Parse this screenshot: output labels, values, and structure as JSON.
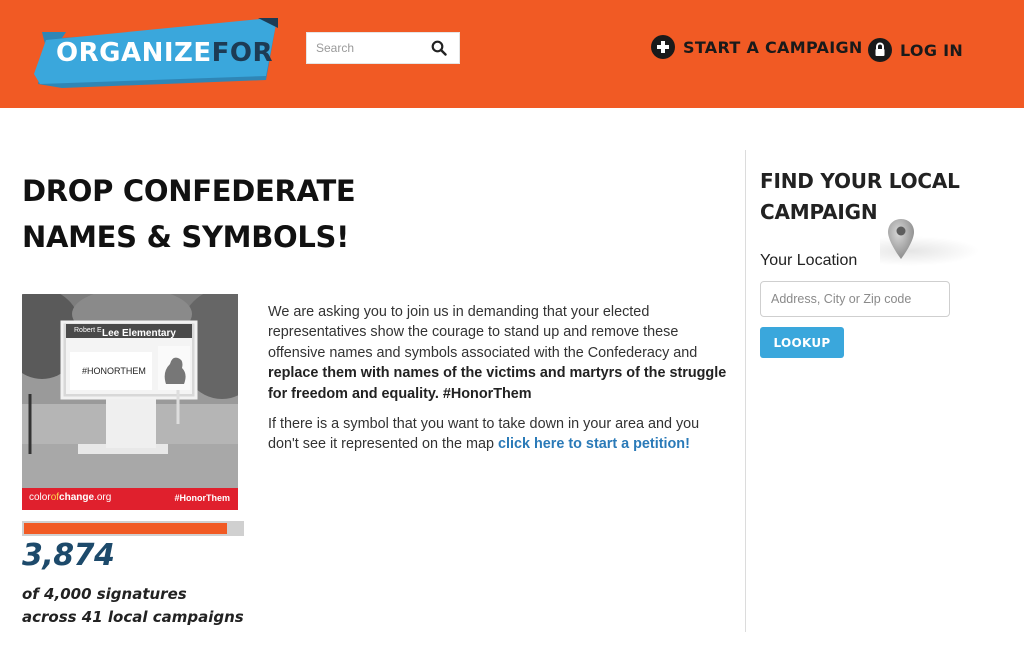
{
  "header": {
    "logo": {
      "main": "ORGANIZE",
      "suffix": "FOR"
    },
    "search": {
      "placeholder": "Search"
    },
    "nav": {
      "start_campaign": "START A CAMPAIGN",
      "log_in": "LOG IN"
    }
  },
  "main": {
    "title_line1": "DROP CONFEDERATE",
    "title_line2": "NAMES & SYMBOLS!",
    "image": {
      "sign_name_small": "Robert E",
      "sign_name": "Lee Elementary",
      "sign_text": "#HONORTHEM",
      "footer_left_a": "color",
      "footer_left_b": "of",
      "footer_left_c": "change",
      "footer_left_d": ".org",
      "footer_right": "#HonorThem"
    },
    "progress": {
      "signatures": 3874,
      "goal": 4000
    },
    "signature_count": "3,874",
    "signature_of": "of 4,000 signatures",
    "signature_across": "across 41 local campaigns",
    "description": {
      "p1_plain": "We are asking you to join us in demanding that your elected representatives show the courage to stand up and remove these offensive names and symbols associated with the Confederacy and ",
      "p1_bold": "replace them with names of the victims and martyrs of the struggle for freedom and equality. #HonorThem",
      "p2_plain": "If there is a symbol that you want to take down in your area and you don't see it represented on the map ",
      "p2_link": "click here to start a petition!"
    }
  },
  "sidebar": {
    "title_line1": "FIND YOUR LOCAL",
    "title_line2": "CAMPAIGN",
    "location_label": "Your Location",
    "location_placeholder": "Address, City or Zip code",
    "lookup_label": "LOOKUP"
  },
  "colors": {
    "header_orange": "#f15a24",
    "logo_blue": "#3aa7dc",
    "logo_dark": "#1d3b54",
    "count_blue": "#1d4a6b",
    "link_blue": "#2a7ab8",
    "button_blue": "#3aa7dc",
    "band_red": "#e0202d"
  },
  "icons": {
    "search": "search-icon",
    "start_campaign": "plus-circle-icon",
    "log_in": "lock-circle-icon",
    "location": "map-pin-icon"
  }
}
